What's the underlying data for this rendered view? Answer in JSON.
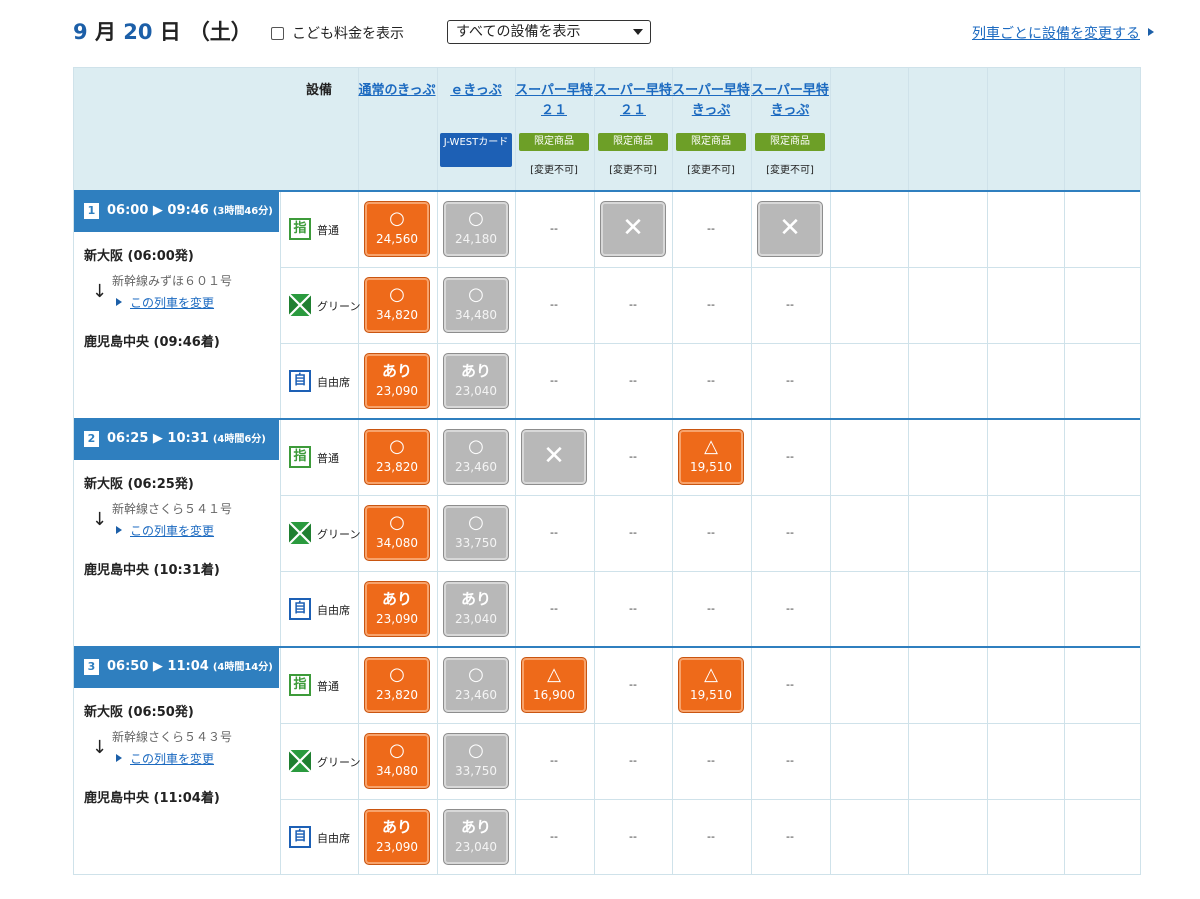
{
  "header": {
    "month": "9",
    "month_unit": "月",
    "day": "20",
    "day_unit": "日",
    "weekday": "（土）",
    "child_fare_label": "こども料金を表示",
    "equipment_filter": "すべての設備を表示",
    "change_by_train_link": "列車ごとに設備を変更する"
  },
  "columns": {
    "equipment": "設備",
    "fares": [
      {
        "title": "通常のきっぷ"
      },
      {
        "title": "ｅきっぷ",
        "badge": "J-WESTカード"
      },
      {
        "title": "スーパー早特２１",
        "tag": "限定商品",
        "note": "[変更不可]"
      },
      {
        "title": "スーパー早特２１",
        "tag": "限定商品",
        "note": "[変更不可]"
      },
      {
        "title": "スーパー早特きっぷ",
        "tag": "限定商品",
        "note": "[変更不可]"
      },
      {
        "title": "スーパー早特きっぷ",
        "tag": "限定商品",
        "note": "[変更不可]"
      }
    ]
  },
  "labels": {
    "change_train": "この列車を変更",
    "dash": "--"
  },
  "icons": {
    "reserved_char": "指",
    "free_char": "自",
    "arrow_down": "↓"
  },
  "trains": [
    {
      "no": "1",
      "time": "06:00 ▶ 09:46",
      "duration": "(3時間46分)",
      "depart": "新大阪 (06:00発)",
      "name": "新幹線みずほ６０１号",
      "arrive": "鹿児島中央 (09:46着)",
      "rows": [
        {
          "seat": "普通",
          "cells": [
            {
              "state": "orange",
              "sym": "○",
              "price": "24,560"
            },
            {
              "state": "gray",
              "sym": "○",
              "price": "24,180"
            },
            {
              "state": "dash"
            },
            {
              "state": "x"
            },
            {
              "state": "dash"
            },
            {
              "state": "x"
            }
          ]
        },
        {
          "seat": "グリーン",
          "cells": [
            {
              "state": "orange",
              "sym": "○",
              "price": "34,820"
            },
            {
              "state": "gray",
              "sym": "○",
              "price": "34,480"
            },
            {
              "state": "dash"
            },
            {
              "state": "dash"
            },
            {
              "state": "dash"
            },
            {
              "state": "dash"
            }
          ]
        },
        {
          "seat": "自由席",
          "cells": [
            {
              "state": "orange",
              "sym": "あり",
              "price": "23,090"
            },
            {
              "state": "gray",
              "sym": "あり",
              "price": "23,040"
            },
            {
              "state": "dash"
            },
            {
              "state": "dash"
            },
            {
              "state": "dash"
            },
            {
              "state": "dash"
            }
          ]
        }
      ]
    },
    {
      "no": "2",
      "time": "06:25 ▶ 10:31",
      "duration": "(4時間6分)",
      "depart": "新大阪 (06:25発)",
      "name": "新幹線さくら５４１号",
      "arrive": "鹿児島中央 (10:31着)",
      "rows": [
        {
          "seat": "普通",
          "cells": [
            {
              "state": "orange",
              "sym": "○",
              "price": "23,820"
            },
            {
              "state": "gray",
              "sym": "○",
              "price": "23,460"
            },
            {
              "state": "x"
            },
            {
              "state": "dash"
            },
            {
              "state": "orange",
              "sym": "△",
              "price": "19,510"
            },
            {
              "state": "dash"
            }
          ]
        },
        {
          "seat": "グリーン",
          "cells": [
            {
              "state": "orange",
              "sym": "○",
              "price": "34,080"
            },
            {
              "state": "gray",
              "sym": "○",
              "price": "33,750"
            },
            {
              "state": "dash"
            },
            {
              "state": "dash"
            },
            {
              "state": "dash"
            },
            {
              "state": "dash"
            }
          ]
        },
        {
          "seat": "自由席",
          "cells": [
            {
              "state": "orange",
              "sym": "あり",
              "price": "23,090"
            },
            {
              "state": "gray",
              "sym": "あり",
              "price": "23,040"
            },
            {
              "state": "dash"
            },
            {
              "state": "dash"
            },
            {
              "state": "dash"
            },
            {
              "state": "dash"
            }
          ]
        }
      ]
    },
    {
      "no": "3",
      "time": "06:50 ▶ 11:04",
      "duration": "(4時間14分)",
      "depart": "新大阪 (06:50発)",
      "name": "新幹線さくら５４３号",
      "arrive": "鹿児島中央 (11:04着)",
      "rows": [
        {
          "seat": "普通",
          "cells": [
            {
              "state": "orange",
              "sym": "○",
              "price": "23,820"
            },
            {
              "state": "gray",
              "sym": "○",
              "price": "23,460"
            },
            {
              "state": "orange",
              "sym": "△",
              "price": "16,900"
            },
            {
              "state": "dash"
            },
            {
              "state": "orange",
              "sym": "△",
              "price": "19,510"
            },
            {
              "state": "dash"
            }
          ]
        },
        {
          "seat": "グリーン",
          "cells": [
            {
              "state": "orange",
              "sym": "○",
              "price": "34,080"
            },
            {
              "state": "gray",
              "sym": "○",
              "price": "33,750"
            },
            {
              "state": "dash"
            },
            {
              "state": "dash"
            },
            {
              "state": "dash"
            },
            {
              "state": "dash"
            }
          ]
        },
        {
          "seat": "自由席",
          "cells": [
            {
              "state": "orange",
              "sym": "あり",
              "price": "23,090"
            },
            {
              "state": "gray",
              "sym": "あり",
              "price": "23,040"
            },
            {
              "state": "dash"
            },
            {
              "state": "dash"
            },
            {
              "state": "dash"
            },
            {
              "state": "dash"
            }
          ]
        }
      ]
    }
  ]
}
